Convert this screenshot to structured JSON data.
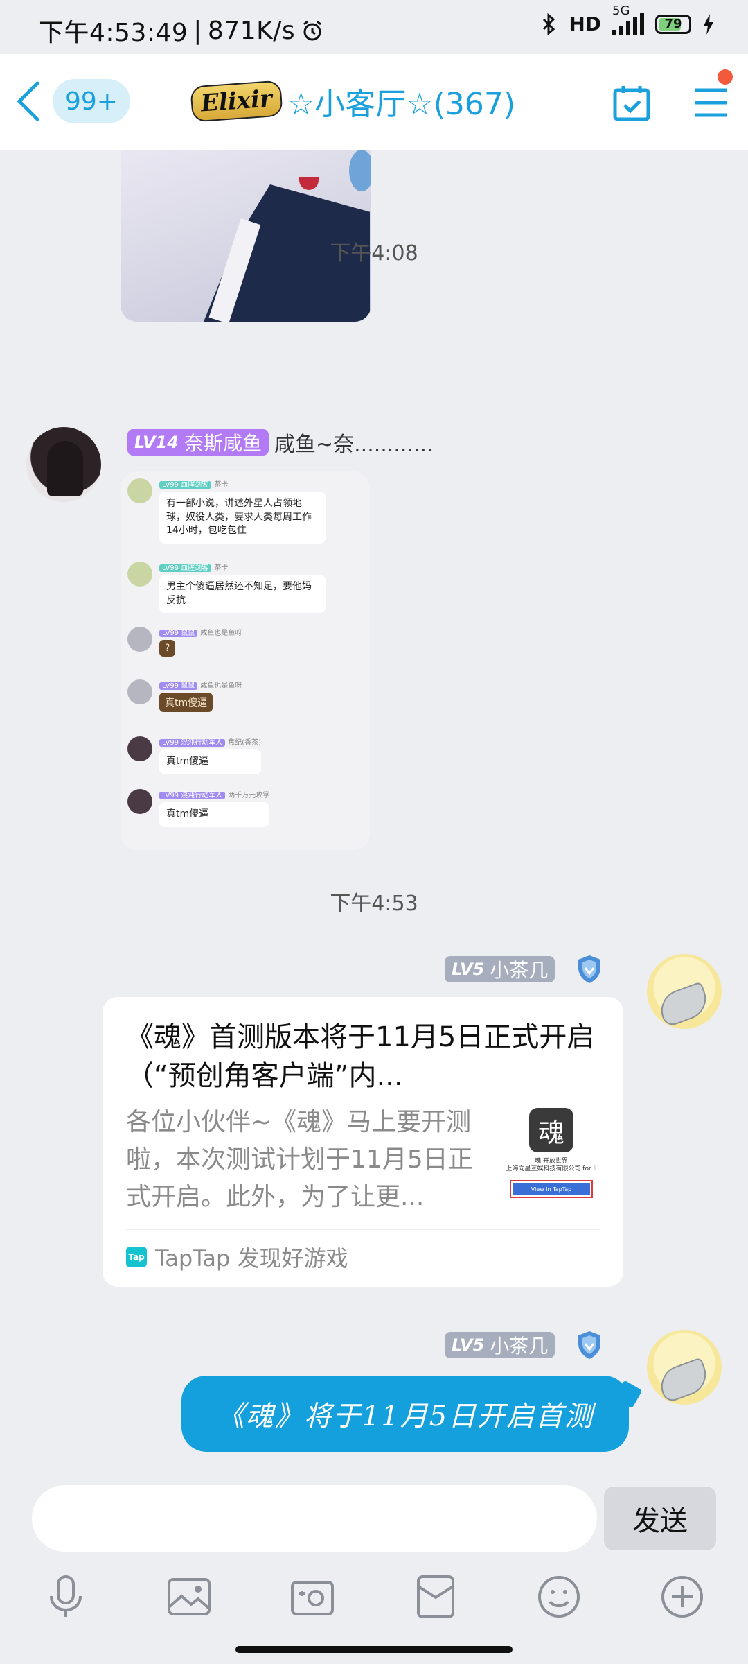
{
  "status_bar": {
    "time": "下午4:53:49",
    "separator": "|",
    "speed": "871K/s",
    "network": "5G",
    "battery": "79"
  },
  "header": {
    "unread_badge": "99+",
    "group_logo": "Elixir",
    "title": "☆小客厅☆(367)"
  },
  "messages": {
    "image_top": {},
    "time1": "下午4:08",
    "msg1": {
      "level": "LV14",
      "title_tag": "奈斯咸鱼",
      "nickname": "咸鱼~奈............",
      "screenshot": [
        {
          "meta": "LV99 血腥剑客",
          "who": "茶卡",
          "text": "有一部小说，讲述外星人占领地球，奴役人类，要求人类每周工作14小时，包吃包住"
        },
        {
          "meta": "LV99 血腥剑客",
          "who": "茶卡",
          "text": "男主个傻逼居然还不知足，要他妈反抗"
        },
        {
          "meta": "LV99 鼠鼠",
          "who": "咸鱼也是鱼呀",
          "sticker": "?"
        },
        {
          "meta": "LV99 鼠鼠",
          "who": "咸鱼也是鱼呀",
          "sticker": "真tm傻逼"
        },
        {
          "meta": "LV99 混沌行动军人",
          "who": "焦纪(香茶)",
          "text": "真tm傻逼"
        },
        {
          "meta": "LV99 混沌行动军人",
          "who": "两千万元攻掌",
          "text": "真tm傻逼"
        }
      ]
    },
    "time2": "下午4:53",
    "msg2": {
      "level": "LV5",
      "nickname": "小茶几",
      "card": {
        "title": "《魂》首测版本将于11月5日正式开启（“预创角客户端”内...",
        "desc": "各位小伙伴~《魂》马上要开测啦，本次测试计划于11月5日正式开启。此外，为了让更...",
        "thumb_logo": "魂",
        "thumb_text1": "魂·开放世界",
        "thumb_text2": "上海向星互娱科技有限公司 for li",
        "thumb_button": "View in TapTap",
        "source_icon": "Tap",
        "source": "TapTap 发现好游戏"
      }
    },
    "msg3": {
      "level": "LV5",
      "nickname": "小茶几",
      "text": "《魂》将于11月5日开启首测"
    }
  },
  "input_bar": {
    "placeholder": "",
    "send_label": "发送"
  },
  "colors": {
    "accent": "#14a0dc",
    "background": "#eceef2",
    "purple_tag": "#b27af5",
    "gray_tag": "#a6adbd"
  }
}
